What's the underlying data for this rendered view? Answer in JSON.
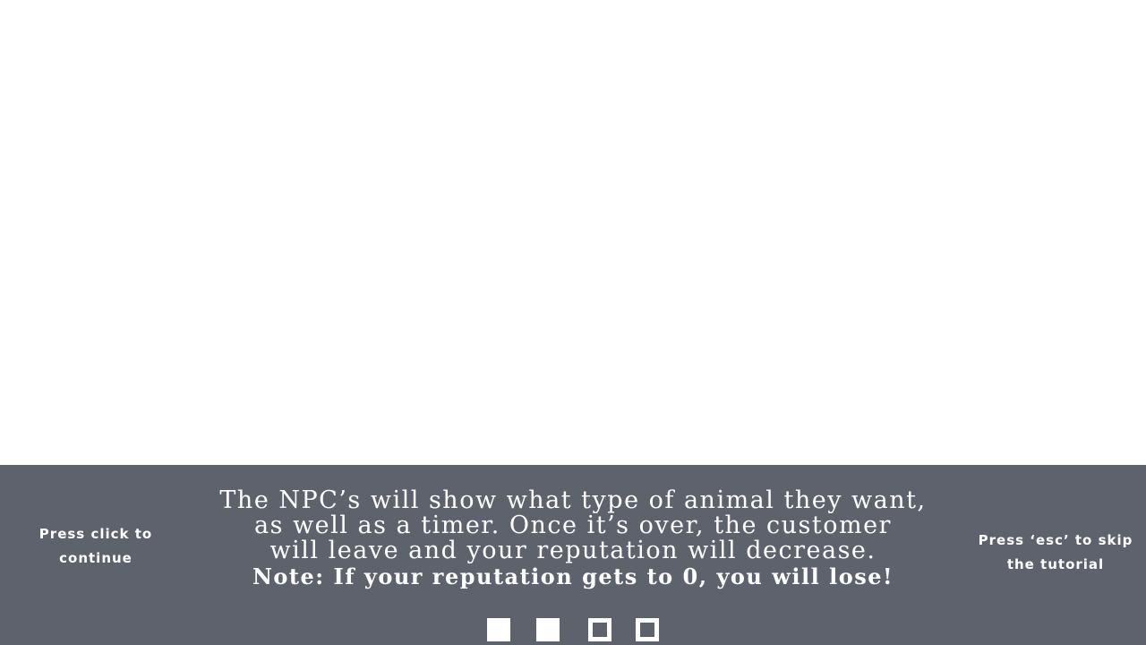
{
  "tutorial": {
    "left_hint": "Press click to continue",
    "right_hint": "Press ‘esc’ to skip the tutorial",
    "message_lines": [
      "The NPC’s will show what type of animal they want,",
      "as well as a timer. Once it’s over, the customer",
      "will leave and your reputation will decrease."
    ],
    "note": "Note: If your reputation gets to 0, you will lose!",
    "pages": [
      {
        "state": "filled"
      },
      {
        "state": "filled"
      },
      {
        "state": "empty"
      },
      {
        "state": "empty"
      }
    ]
  },
  "colors": {
    "panel_background": "#5e626d",
    "text": "#ffffff",
    "game_background": "#ffffff"
  }
}
